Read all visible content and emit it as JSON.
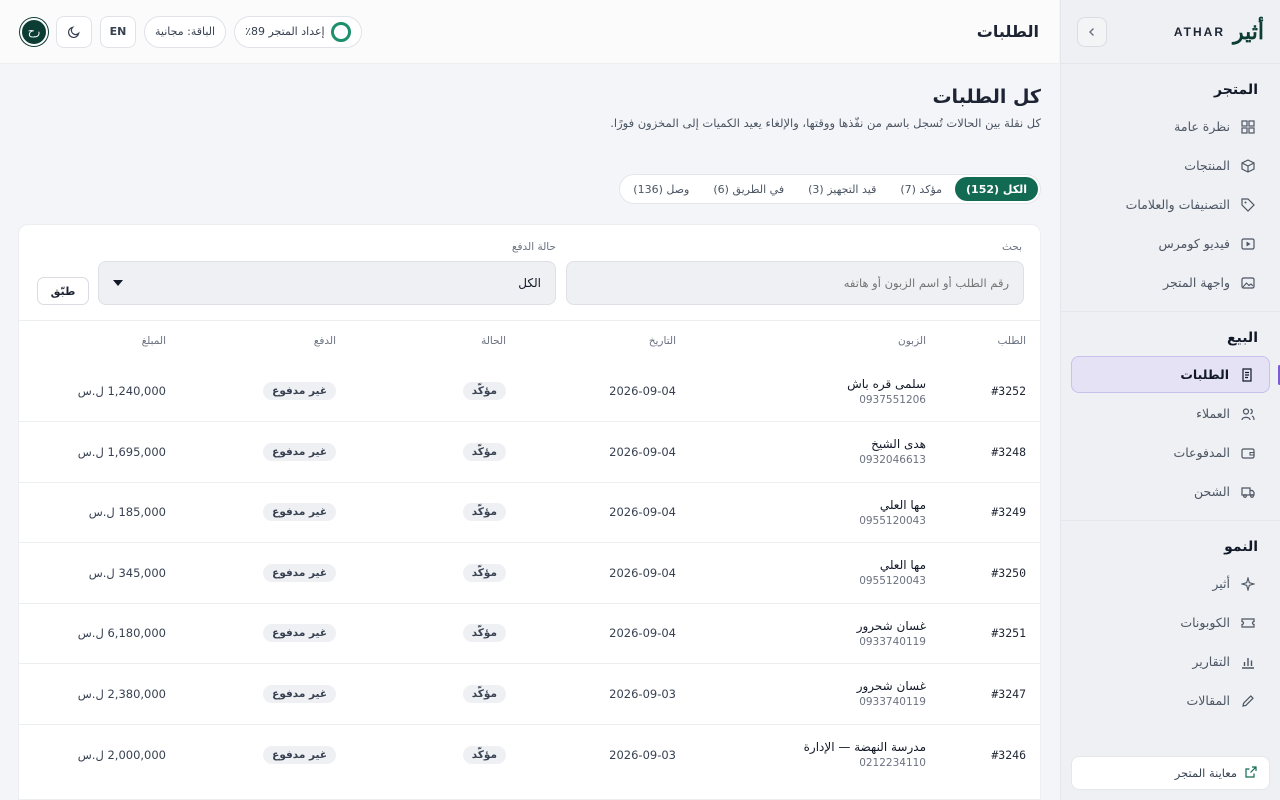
{
  "brand": {
    "logo_mark": "أثير",
    "name": "ATHAR"
  },
  "sidebar": {
    "sections": [
      {
        "title": "المتجر",
        "items": [
          {
            "label": "نظرة عامة",
            "icon": "grid-icon"
          },
          {
            "label": "المنتجات",
            "icon": "box-icon"
          },
          {
            "label": "التصنيفات والعلامات",
            "icon": "tag-icon"
          },
          {
            "label": "فيديو كومرس",
            "icon": "video-icon"
          },
          {
            "label": "واجهة المتجر",
            "icon": "image-icon"
          }
        ]
      },
      {
        "title": "البيع",
        "items": [
          {
            "label": "الطلبات",
            "icon": "receipt-icon",
            "active": true
          },
          {
            "label": "العملاء",
            "icon": "users-icon"
          },
          {
            "label": "المدفوعات",
            "icon": "wallet-icon"
          },
          {
            "label": "الشحن",
            "icon": "truck-icon"
          }
        ]
      },
      {
        "title": "النمو",
        "items": [
          {
            "label": "أثير",
            "icon": "sparkle-icon"
          },
          {
            "label": "الكوبونات",
            "icon": "ticket-icon"
          },
          {
            "label": "التقارير",
            "icon": "bar-chart-icon"
          },
          {
            "label": "المقالات",
            "icon": "pencil-icon"
          }
        ]
      }
    ],
    "footer_label": "معاينة المتجر"
  },
  "topbar": {
    "title": "الطلبات",
    "setup_label": "إعداد المتجر 89٪",
    "plan_label": "الباقة: مجانية",
    "lang_label": "EN",
    "avatar_initials": "رح"
  },
  "page": {
    "heading": "كل الطلبات",
    "subtitle": "كل نقلة بين الحالات تُسجل باسم من نفّذها ووقتها، والإلغاء يعيد الكميات إلى المخزون فورًا."
  },
  "tabs": [
    {
      "label": "الكل (152)",
      "active": true
    },
    {
      "label": "مؤكد (7)"
    },
    {
      "label": "قيد التجهيز (3)"
    },
    {
      "label": "في الطريق (6)"
    },
    {
      "label": "وصل (136)"
    }
  ],
  "filters": {
    "search_label": "بحث",
    "search_placeholder": "رقم الطلب أو اسم الزبون أو هاتفه",
    "payment_label": "حالة الدفع",
    "payment_value": "الكل",
    "apply_label": "طبّق"
  },
  "table": {
    "headers": [
      "الطلب",
      "الزبون",
      "التاريخ",
      "الحالة",
      "الدفع",
      "المبلغ"
    ],
    "rows": [
      {
        "id": "#3252",
        "name": "سلمى قره باش",
        "phone": "0937551206",
        "date": "2026-09-04",
        "status": "مؤكّد",
        "payment": "غير مدفوع",
        "amount": "1,240,000 ل.س"
      },
      {
        "id": "#3248",
        "name": "هدى الشيخ",
        "phone": "0932046613",
        "date": "2026-09-04",
        "status": "مؤكّد",
        "payment": "غير مدفوع",
        "amount": "1,695,000 ل.س"
      },
      {
        "id": "#3249",
        "name": "مها العلي",
        "phone": "0955120043",
        "date": "2026-09-04",
        "status": "مؤكّد",
        "payment": "غير مدفوع",
        "amount": "185,000 ل.س"
      },
      {
        "id": "#3250",
        "name": "مها العلي",
        "phone": "0955120043",
        "date": "2026-09-04",
        "status": "مؤكّد",
        "payment": "غير مدفوع",
        "amount": "345,000 ل.س"
      },
      {
        "id": "#3251",
        "name": "غسان شحرور",
        "phone": "0933740119",
        "date": "2026-09-04",
        "status": "مؤكّد",
        "payment": "غير مدفوع",
        "amount": "6,180,000 ل.س"
      },
      {
        "id": "#3247",
        "name": "غسان شحرور",
        "phone": "0933740119",
        "date": "2026-09-03",
        "status": "مؤكّد",
        "payment": "غير مدفوع",
        "amount": "2,380,000 ل.س"
      },
      {
        "id": "#3246",
        "name": "مدرسة النهضة — الإدارة",
        "phone": "0212234110",
        "date": "2026-09-03",
        "status": "مؤكّد",
        "payment": "غير مدفوع",
        "amount": "2,000,000 ل.س"
      }
    ]
  },
  "colors": {
    "primary": "#136a52",
    "brand_dark": "#0b3d34",
    "active_accent": "#7c5cd6",
    "active_bg": "#e6e2f6"
  }
}
